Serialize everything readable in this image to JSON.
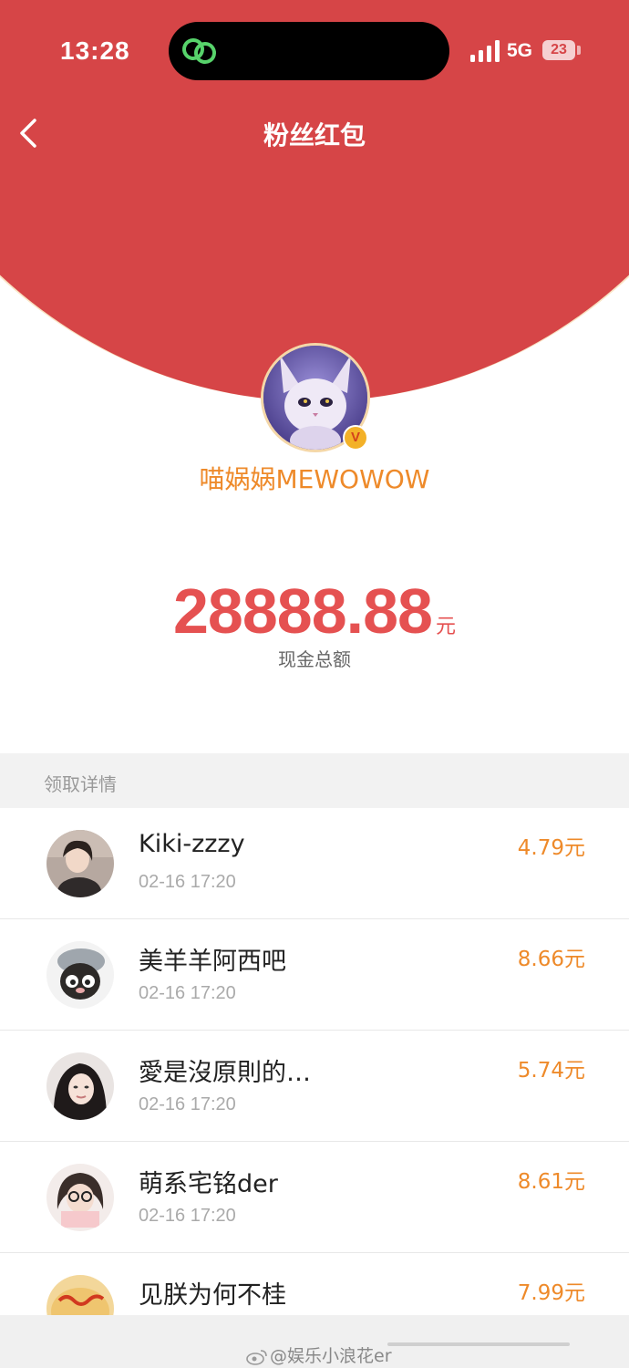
{
  "status_bar": {
    "time": "13:28",
    "network": "5G",
    "battery": "23"
  },
  "nav": {
    "title": "粉丝红包"
  },
  "sender": {
    "name": "喵娲娲MEWOWOW",
    "verified_badge": "V"
  },
  "total": {
    "amount": "28888.88",
    "unit": "元",
    "caption": "现金总额"
  },
  "details": {
    "header": "领取详情",
    "items": [
      {
        "name": "Kiki-zzzy",
        "time": "02-16 17:20",
        "amount": "4.79元"
      },
      {
        "name": "美羊羊阿西吧",
        "time": "02-16 17:20",
        "amount": "8.66元"
      },
      {
        "name": "愛是沒原則的…",
        "time": "02-16 17:20",
        "amount": "5.74元"
      },
      {
        "name": "萌系宅铭der",
        "time": "02-16 17:20",
        "amount": "8.61元"
      },
      {
        "name": "见朕为何不桂",
        "time": "",
        "amount": "7.99元"
      }
    ]
  },
  "watermark": "@娱乐小浪花er",
  "colors": {
    "header_red": "#d64547",
    "accent_orange": "#ee8a2a",
    "amount_red": "#e55151"
  },
  "icons": [
    "chain-link-icon",
    "signal-icon",
    "battery-icon",
    "back-arrow-icon",
    "verified-badge-icon",
    "weibo-icon"
  ]
}
